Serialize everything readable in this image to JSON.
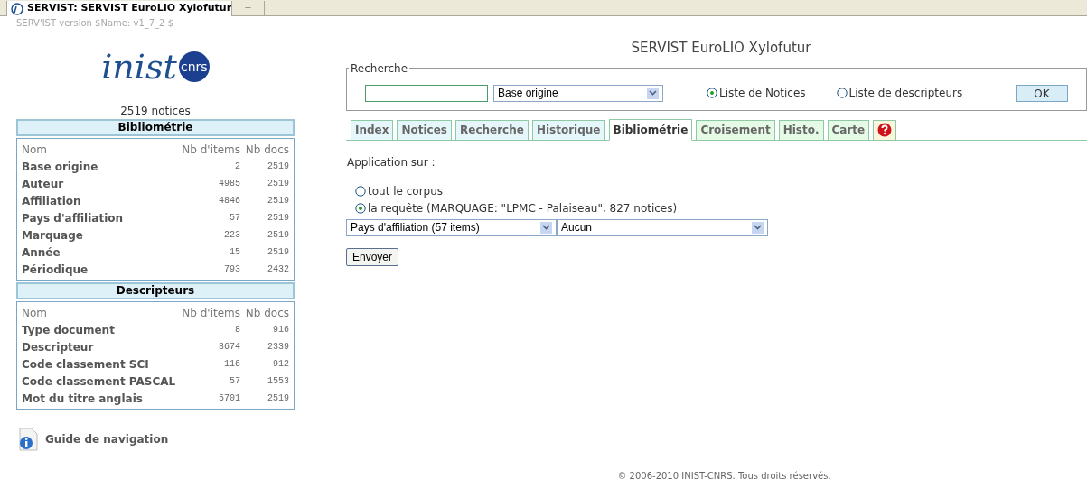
{
  "browser_tab": {
    "title": "SERVIST: SERVIST EuroLIO Xylofutur",
    "new_tab": "+"
  },
  "version": "SERV'IST version $Name: v1_7_2 $",
  "logo": {
    "text": "inist",
    "badge": "cnrs"
  },
  "notice_count": "2519 notices",
  "panels": [
    {
      "title": "Bibliométrie",
      "columns": [
        "Nom",
        "Nb d'items",
        "Nb docs"
      ],
      "rows": [
        [
          "Base origine",
          "2",
          "2519"
        ],
        [
          "Auteur",
          "4985",
          "2519"
        ],
        [
          "Affiliation",
          "4846",
          "2519"
        ],
        [
          "Pays d'affiliation",
          "57",
          "2519"
        ],
        [
          "Marquage",
          "223",
          "2519"
        ],
        [
          "Année",
          "15",
          "2519"
        ],
        [
          "Périodique",
          "793",
          "2432"
        ]
      ]
    },
    {
      "title": "Descripteurs",
      "columns": [
        "Nom",
        "Nb d'items",
        "Nb docs"
      ],
      "rows": [
        [
          "Type document",
          "8",
          "916"
        ],
        [
          "Descripteur",
          "8674",
          "2339"
        ],
        [
          "Code classement SCI",
          "116",
          "912"
        ],
        [
          "Code classement PASCAL",
          "57",
          "1553"
        ],
        [
          "Mot du titre anglais",
          "5701",
          "2519"
        ]
      ]
    }
  ],
  "guide": "Guide de navigation",
  "title": "SERVIST EuroLIO Xylofutur",
  "search": {
    "legend": "Recherche",
    "field_select": "Base origine",
    "options": [
      {
        "label": "Liste de Notices",
        "selected": true
      },
      {
        "label": "Liste de descripteurs",
        "selected": false
      }
    ],
    "ok": "OK"
  },
  "tabs": [
    {
      "label": "Index",
      "color": "#e6f7fb",
      "selected": false
    },
    {
      "label": "Notices",
      "color": "#e6f7fb",
      "selected": false
    },
    {
      "label": "Recherche",
      "color": "#e6f7fb",
      "selected": false
    },
    {
      "label": "Historique",
      "color": "#e6f7fb",
      "selected": false
    },
    {
      "label": "Bibliométrie",
      "color": "#ffffff",
      "selected": true
    },
    {
      "label": "Croisement",
      "color": "#e6fbe6",
      "selected": false
    },
    {
      "label": "Histo.",
      "color": "#e6fbe6",
      "selected": false
    },
    {
      "label": "Carte",
      "color": "#e6fbe6",
      "selected": false
    },
    {
      "kind": "help",
      "color": "#fdf6dc",
      "selected": false
    }
  ],
  "application_label": "Application sur :",
  "scope": [
    {
      "label": "tout le corpus",
      "selected": false
    },
    {
      "label": "la requête (MARQUAGE: \"LPMC - Palaiseau\", 827 notices)",
      "selected": true
    }
  ],
  "selects": [
    "Pays d'affiliation (57 items)",
    "Aucun"
  ],
  "submit": "Envoyer",
  "footer": "© 2006-2010 INIST-CNRS. Tous droits réservés."
}
